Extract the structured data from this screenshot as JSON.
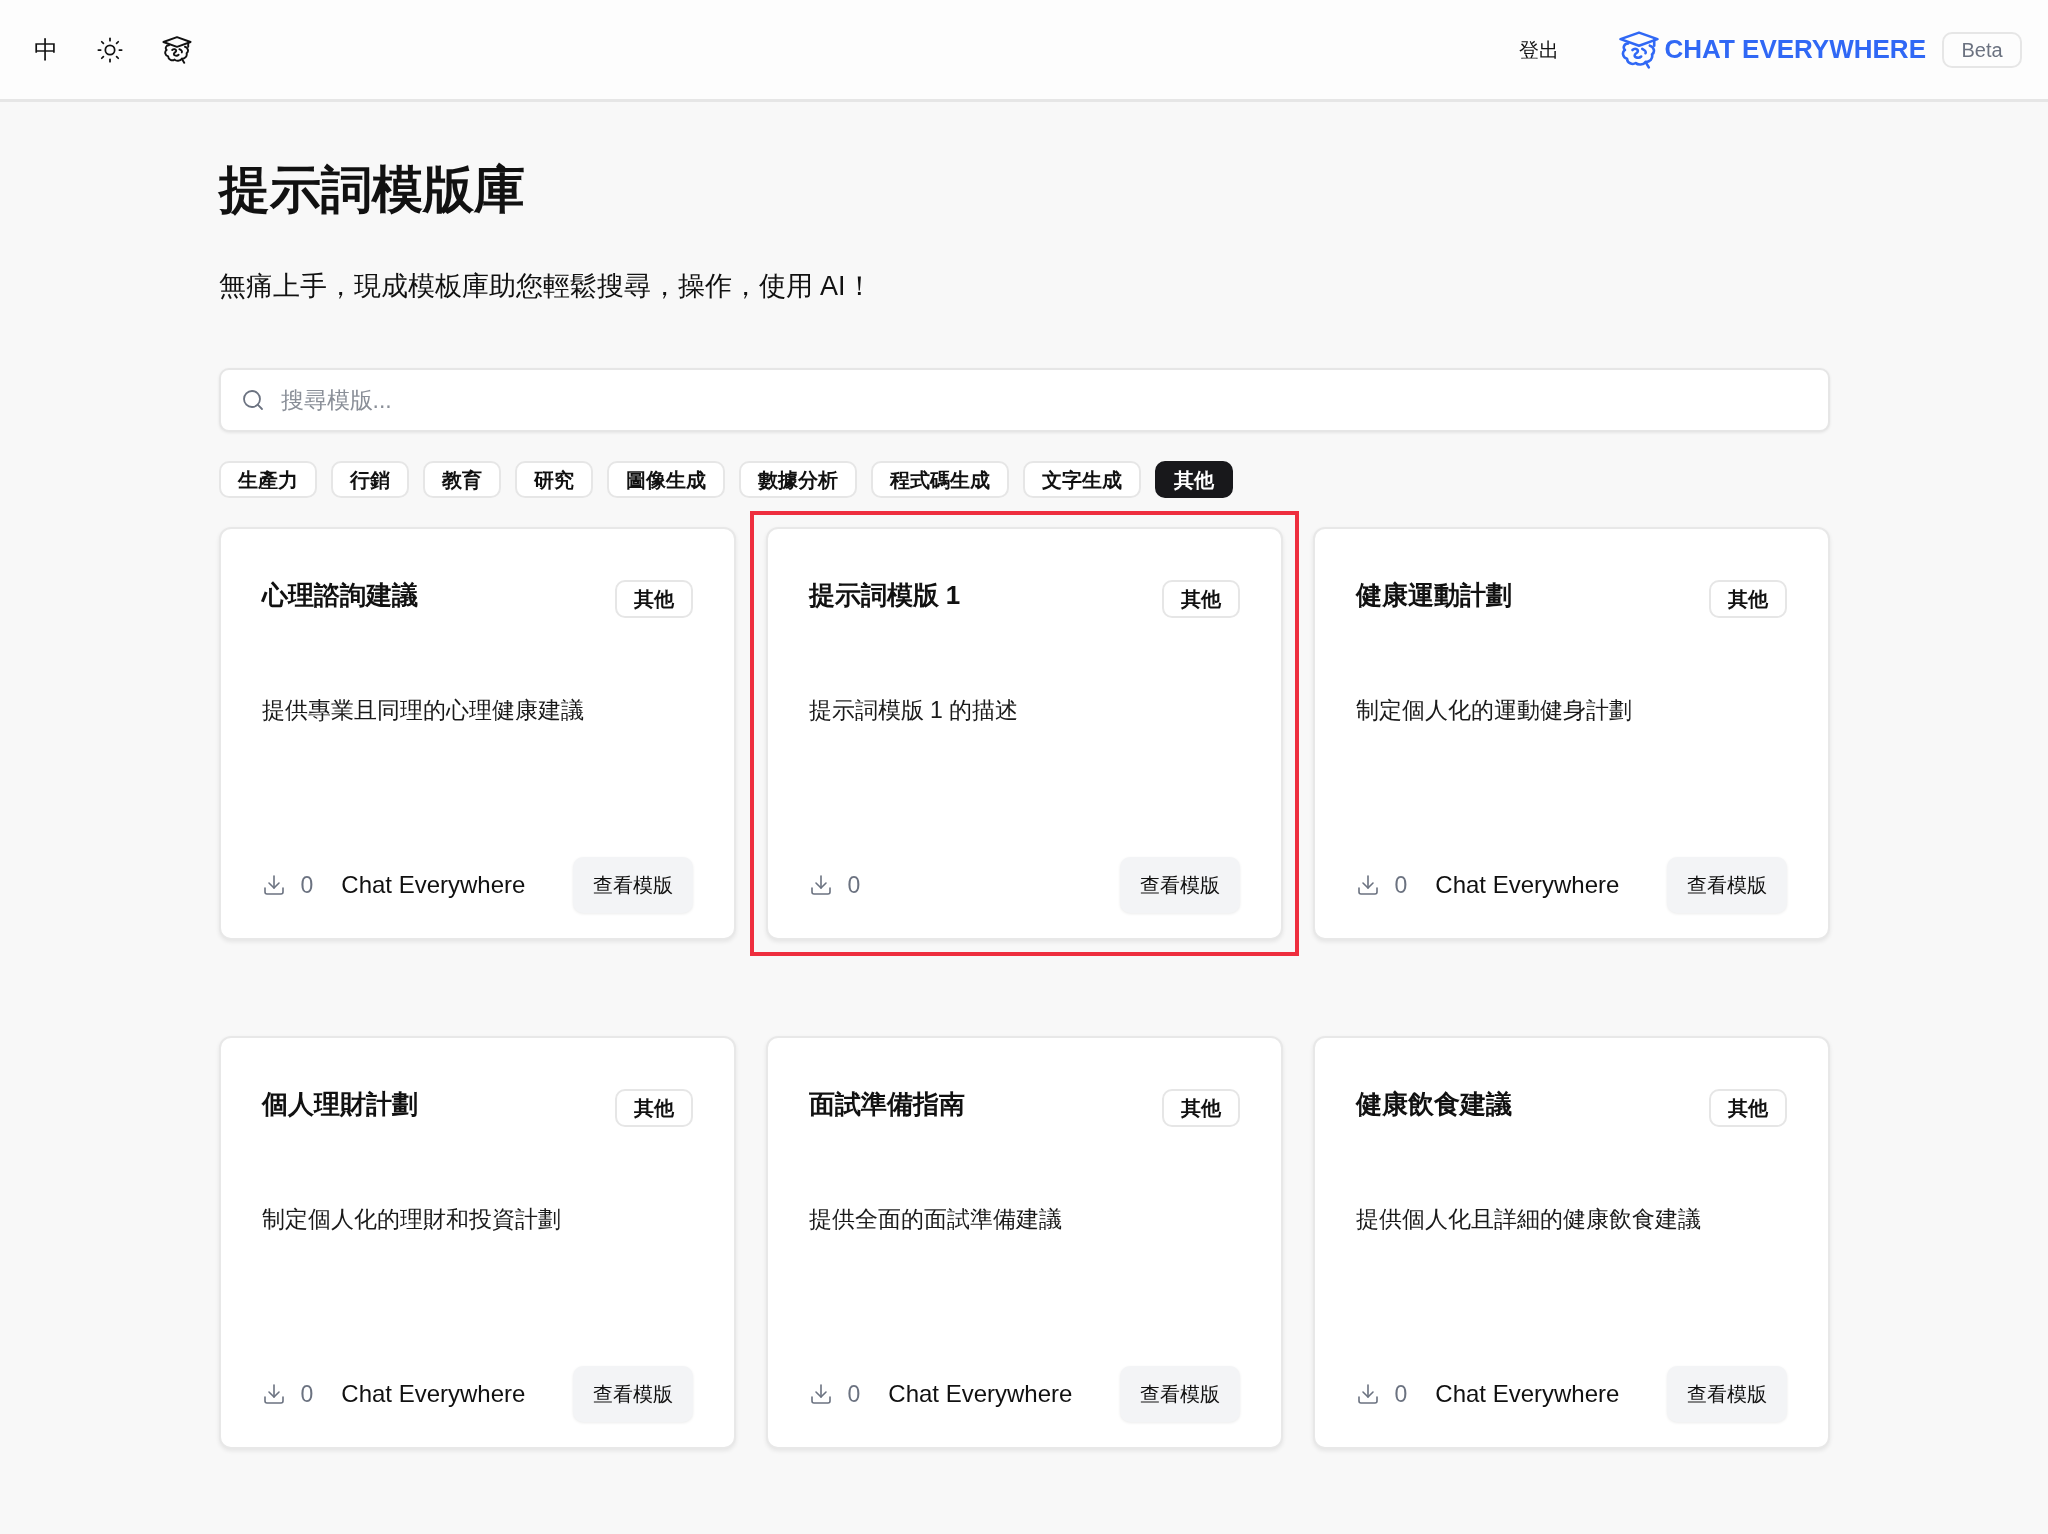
{
  "header": {
    "language_toggle": "中",
    "logout": "登出",
    "brand": {
      "name": "CHAT EVERYWHERE",
      "badge": "Beta"
    }
  },
  "page": {
    "title": "提示詞模版庫",
    "subtitle": "無痛上手，現成模板庫助您輕鬆搜尋，操作，使用 AI！"
  },
  "search": {
    "placeholder": "搜尋模版..."
  },
  "categories": [
    {
      "label": "生產力",
      "selected": false
    },
    {
      "label": "行銷",
      "selected": false
    },
    {
      "label": "教育",
      "selected": false
    },
    {
      "label": "研究",
      "selected": false
    },
    {
      "label": "圖像生成",
      "selected": false
    },
    {
      "label": "數據分析",
      "selected": false
    },
    {
      "label": "程式碼生成",
      "selected": false
    },
    {
      "label": "文字生成",
      "selected": false
    },
    {
      "label": "其他",
      "selected": true
    }
  ],
  "cards": [
    {
      "title": "心理諮詢建議",
      "tag": "其他",
      "description": "提供專業且同理的心理健康建議",
      "downloads": "0",
      "author": "Chat Everywhere",
      "button": "查看模版",
      "highlighted": false
    },
    {
      "title": "提示詞模版 1",
      "tag": "其他",
      "description": "提示詞模版 1 的描述",
      "downloads": "0",
      "button": "查看模版",
      "highlighted": true
    },
    {
      "title": "健康運動計劃",
      "tag": "其他",
      "description": "制定個人化的運動健身計劃",
      "downloads": "0",
      "author": "Chat Everywhere",
      "button": "查看模版",
      "highlighted": false
    },
    {
      "title": "個人理財計劃",
      "tag": "其他",
      "description": "制定個人化的理財和投資計劃",
      "downloads": "0",
      "author": "Chat Everywhere",
      "button": "查看模版",
      "highlighted": false
    },
    {
      "title": "面試準備指南",
      "tag": "其他",
      "description": "提供全面的面試準備建議",
      "downloads": "0",
      "author": "Chat Everywhere",
      "button": "查看模版",
      "highlighted": false
    },
    {
      "title": "健康飲食建議",
      "tag": "其他",
      "description": "提供個人化且詳細的健康飲食建議",
      "downloads": "0",
      "author": "Chat Everywhere",
      "button": "查看模版",
      "highlighted": false
    }
  ]
}
